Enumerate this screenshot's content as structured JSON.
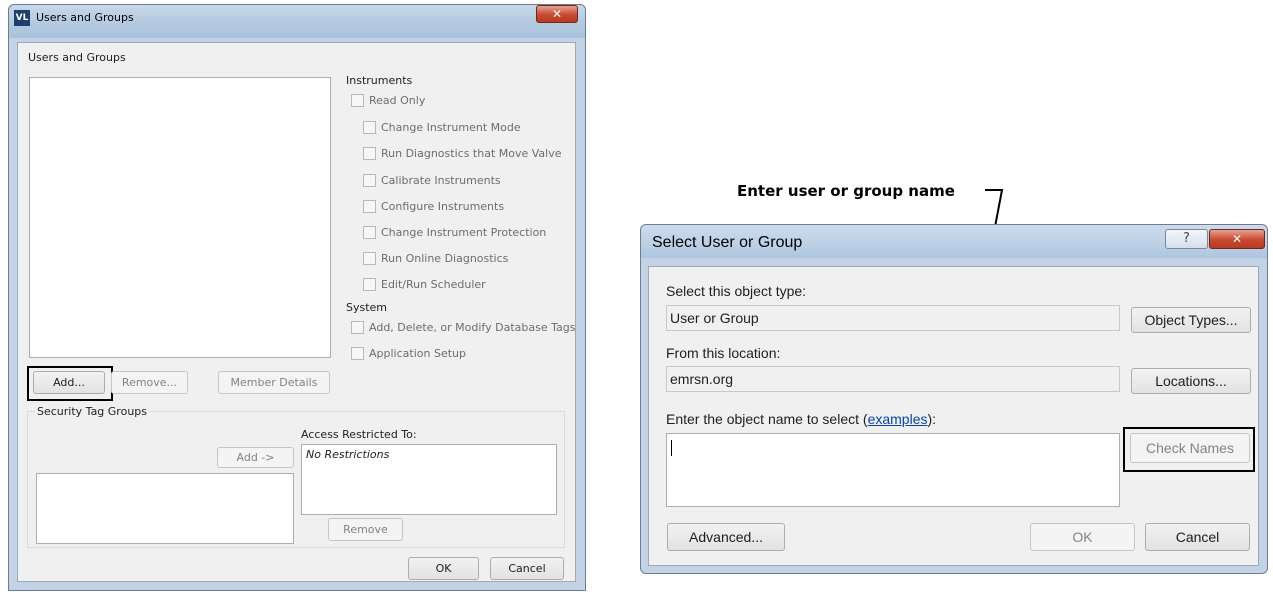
{
  "left_dialog": {
    "title": "Users and Groups",
    "close_glyph": "✕",
    "app_icon_text": "VL",
    "section_label": "Users and Groups",
    "instruments_label": "Instruments",
    "instrument_checkboxes": [
      "Read Only",
      "Change Instrument Mode",
      "Run Diagnostics that Move Valve",
      "Calibrate Instruments",
      "Configure Instruments",
      "Change Instrument Protection",
      "Run Online Diagnostics",
      "Edit/Run Scheduler"
    ],
    "system_label": "System",
    "system_checkboxes": [
      "Add, Delete, or Modify Database Tags",
      "Application Setup"
    ],
    "add_button": "Add...",
    "remove_button": "Remove...",
    "member_details_button": "Member Details",
    "security_tag_groups_label": "Security Tag Groups",
    "add_arrow_button": "Add ->",
    "access_restricted_label": "Access Restricted To:",
    "no_restrictions_text": "No Restrictions",
    "remove_tag_button": "Remove",
    "ok_button": "OK",
    "cancel_button": "Cancel"
  },
  "annotation": {
    "text": "Enter user or group name"
  },
  "right_dialog": {
    "title": "Select User or Group",
    "help_glyph": "?",
    "close_glyph": "✕",
    "object_type_label": "Select this object type:",
    "object_type_value": "User or Group",
    "object_types_button": "Object Types...",
    "location_label": "From this location:",
    "location_value": "emrsn.org",
    "locations_button": "Locations...",
    "enter_label_prefix": "Enter the object name to select (",
    "examples_link": "examples",
    "enter_label_suffix": "):",
    "check_names_button": "Check Names",
    "advanced_button": "Advanced...",
    "ok_button": "OK",
    "cancel_button": "Cancel"
  }
}
